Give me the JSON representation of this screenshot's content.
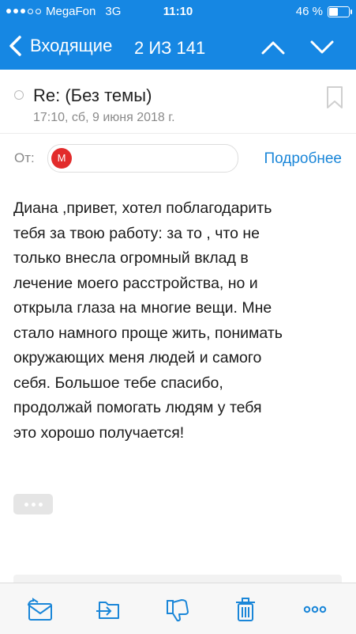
{
  "status": {
    "carrier": "MegaFon",
    "network": "3G",
    "time": "11:10",
    "battery_percent": "46 %"
  },
  "nav": {
    "back_label": "Входящие",
    "counter": "2 ИЗ 141"
  },
  "message": {
    "subject": "Re: (Без темы)",
    "date": "17:10, сб, 9 июня 2018 г.",
    "from_label": "От:",
    "sender_avatar_letter": "М",
    "details_link": "Подробнее",
    "body": "Диана ,привет, хотел поблагодарить\nтебя за твою работу: за то , что не\nтолько внесла огромный вклад в\nлечение моего расстройства, но и\nоткрыла глаза на многие вещи. Мне\nстало намного проще жить, понимать\nокружающих меня людей и самого\nсебя. Большое тебе спасибо,\nпродолжай помогать людям у тебя\nэто хорошо получается!"
  },
  "colors": {
    "header_bg": "#1687e3",
    "link": "#1a86d8",
    "avatar_bg": "#e22b2b"
  },
  "icons": [
    "back-chevron-icon",
    "up-arrow-icon",
    "down-arrow-icon",
    "bookmark-icon",
    "reply-icon",
    "move-to-folder-icon",
    "spam-icon",
    "trash-icon",
    "more-icon"
  ]
}
